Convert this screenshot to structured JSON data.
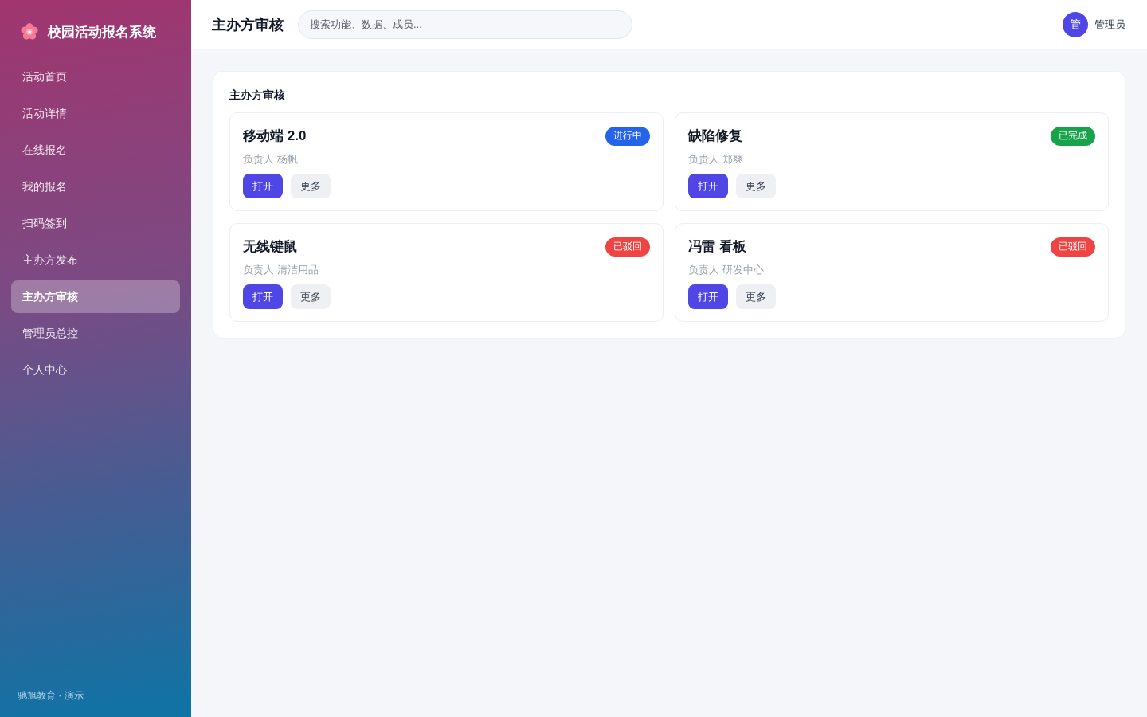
{
  "sidebar": {
    "brand": "校园活动报名系统",
    "items": [
      {
        "label": "活动首页",
        "selected": false
      },
      {
        "label": "活动详情",
        "selected": false
      },
      {
        "label": "在线报名",
        "selected": false
      },
      {
        "label": "我的报名",
        "selected": false
      },
      {
        "label": "扫码签到",
        "selected": false
      },
      {
        "label": "主办方发布",
        "selected": false
      },
      {
        "label": "主办方审核",
        "selected": true
      },
      {
        "label": "管理员总控",
        "selected": false
      },
      {
        "label": "个人中心",
        "selected": false
      }
    ],
    "footer": "驰旭教育 · 演示"
  },
  "header": {
    "title": "主办方审核",
    "search": {
      "placeholder": "搜索功能、数据、成员..."
    },
    "user": {
      "avatar": "管",
      "name": "管理员"
    }
  },
  "panel": {
    "title": "主办方审核",
    "cards": [
      {
        "title": "移动端 2.0",
        "status": "进行中",
        "color": "#2563eb",
        "owner": "负责人 杨帆",
        "actions": [
          "打开",
          "更多"
        ]
      },
      {
        "title": "缺陷修复",
        "status": "已完成",
        "color": "#16a34a",
        "owner": "负责人 郑爽",
        "actions": [
          "打开",
          "更多"
        ]
      },
      {
        "title": "无线键鼠",
        "status": "已驳回",
        "color": "#ef4444",
        "owner": "负责人 清洁用品",
        "actions": [
          "打开",
          "更多"
        ]
      },
      {
        "title": "冯雷 看板",
        "status": "已驳回",
        "color": "#ef4444",
        "owner": "负责人 研发中心",
        "actions": [
          "打开",
          "更多"
        ]
      }
    ]
  }
}
